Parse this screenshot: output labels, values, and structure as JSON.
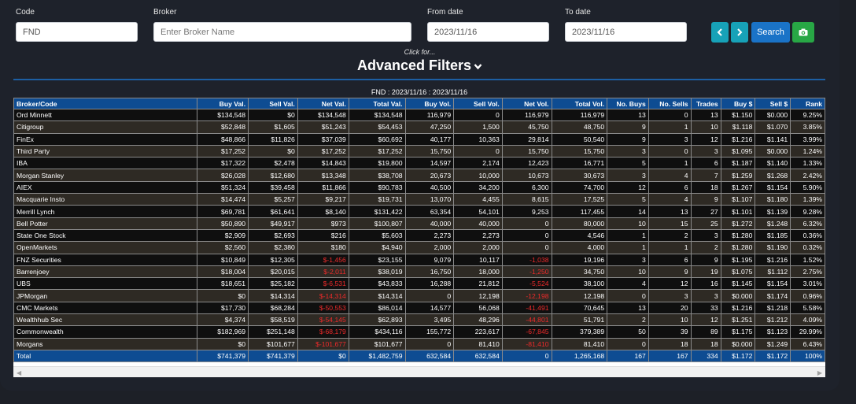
{
  "filters": {
    "code_label": "Code",
    "code_value": "FND",
    "broker_label": "Broker",
    "broker_placeholder": "Enter Broker Name",
    "from_label": "From date",
    "from_value": "2023/11/16",
    "to_label": "To date",
    "to_value": "2023/11/16",
    "search_label": "Search"
  },
  "advanced": {
    "click_for": "Click for...",
    "title": "Advanced Filters"
  },
  "caption": "FND : 2023/11/16 : 2023/11/16",
  "colors": {
    "header_bg": "#0e4c92",
    "negative": "#ee2a2a",
    "accent": "#1a73c7",
    "teal": "#17a2b8",
    "green": "#28a745"
  },
  "icons": {
    "prev": "chevron-left-icon",
    "next": "chevron-right-icon",
    "camera": "camera-icon",
    "advanced": "chevron-down-icon"
  },
  "table": {
    "columns": [
      "Broker/Code",
      "Buy Val.",
      "Sell Val.",
      "Net Val.",
      "Total Val.",
      "Buy Vol.",
      "Sell Vol.",
      "Net Vol.",
      "Total Vol.",
      "No. Buys",
      "No. Sells",
      "Trades",
      "Buy $",
      "Sell $",
      "Rank"
    ],
    "rows": [
      [
        "Ord Minnett",
        "$134,548",
        "$0",
        "$134,548",
        "$134,548",
        "116,979",
        "0",
        "116,979",
        "116,979",
        "13",
        "0",
        "13",
        "$1.150",
        "$0.000",
        "9.25%"
      ],
      [
        "Citigroup",
        "$52,848",
        "$1,605",
        "$51,243",
        "$54,453",
        "47,250",
        "1,500",
        "45,750",
        "48,750",
        "9",
        "1",
        "10",
        "$1.118",
        "$1.070",
        "3.85%"
      ],
      [
        "FinEx",
        "$48,866",
        "$11,826",
        "$37,039",
        "$60,692",
        "40,177",
        "10,363",
        "29,814",
        "50,540",
        "9",
        "3",
        "12",
        "$1.216",
        "$1.141",
        "3.99%"
      ],
      [
        "Third Party",
        "$17,252",
        "$0",
        "$17,252",
        "$17,252",
        "15,750",
        "0",
        "15,750",
        "15,750",
        "3",
        "0",
        "3",
        "$1.095",
        "$0.000",
        "1.24%"
      ],
      [
        "IBA",
        "$17,322",
        "$2,478",
        "$14,843",
        "$19,800",
        "14,597",
        "2,174",
        "12,423",
        "16,771",
        "5",
        "1",
        "6",
        "$1.187",
        "$1.140",
        "1.33%"
      ],
      [
        "Morgan Stanley",
        "$26,028",
        "$12,680",
        "$13,348",
        "$38,708",
        "20,673",
        "10,000",
        "10,673",
        "30,673",
        "3",
        "4",
        "7",
        "$1.259",
        "$1.268",
        "2.42%"
      ],
      [
        "AIEX",
        "$51,324",
        "$39,458",
        "$11,866",
        "$90,783",
        "40,500",
        "34,200",
        "6,300",
        "74,700",
        "12",
        "6",
        "18",
        "$1.267",
        "$1.154",
        "5.90%"
      ],
      [
        "Macquarie Insto",
        "$14,474",
        "$5,257",
        "$9,217",
        "$19,731",
        "13,070",
        "4,455",
        "8,615",
        "17,525",
        "5",
        "4",
        "9",
        "$1.107",
        "$1.180",
        "1.39%"
      ],
      [
        "Merrill Lynch",
        "$69,781",
        "$61,641",
        "$8,140",
        "$131,422",
        "63,354",
        "54,101",
        "9,253",
        "117,455",
        "14",
        "13",
        "27",
        "$1.101",
        "$1.139",
        "9.28%"
      ],
      [
        "Bell Potter",
        "$50,890",
        "$49,917",
        "$973",
        "$100,807",
        "40,000",
        "40,000",
        "0",
        "80,000",
        "10",
        "15",
        "25",
        "$1.272",
        "$1.248",
        "6.32%"
      ],
      [
        "State One Stock",
        "$2,909",
        "$2,693",
        "$216",
        "$5,603",
        "2,273",
        "2,273",
        "0",
        "4,546",
        "1",
        "2",
        "3",
        "$1.280",
        "$1.185",
        "0.36%"
      ],
      [
        "OpenMarkets",
        "$2,560",
        "$2,380",
        "$180",
        "$4,940",
        "2,000",
        "2,000",
        "0",
        "4,000",
        "1",
        "1",
        "2",
        "$1.280",
        "$1.190",
        "0.32%"
      ],
      [
        "FNZ Securities",
        "$10,849",
        "$12,305",
        "$-1,456",
        "$23,155",
        "9,079",
        "10,117",
        "-1,038",
        "19,196",
        "3",
        "6",
        "9",
        "$1.195",
        "$1.216",
        "1.52%"
      ],
      [
        "Barrenjoey",
        "$18,004",
        "$20,015",
        "$-2,011",
        "$38,019",
        "16,750",
        "18,000",
        "-1,250",
        "34,750",
        "10",
        "9",
        "19",
        "$1.075",
        "$1.112",
        "2.75%"
      ],
      [
        "UBS",
        "$18,651",
        "$25,182",
        "$-6,531",
        "$43,833",
        "16,288",
        "21,812",
        "-5,524",
        "38,100",
        "4",
        "12",
        "16",
        "$1.145",
        "$1.154",
        "3.01%"
      ],
      [
        "JPMorgan",
        "$0",
        "$14,314",
        "$-14,314",
        "$14,314",
        "0",
        "12,198",
        "-12,198",
        "12,198",
        "0",
        "3",
        "3",
        "$0.000",
        "$1.174",
        "0.96%"
      ],
      [
        "CMC Markets",
        "$17,730",
        "$68,284",
        "$-50,553",
        "$86,014",
        "14,577",
        "56,068",
        "-41,491",
        "70,645",
        "13",
        "20",
        "33",
        "$1.216",
        "$1.218",
        "5.58%"
      ],
      [
        "Wealthhub Sec",
        "$4,374",
        "$58,519",
        "$-54,145",
        "$62,893",
        "3,495",
        "48,296",
        "-44,801",
        "51,791",
        "2",
        "10",
        "12",
        "$1.251",
        "$1.212",
        "4.09%"
      ],
      [
        "Commonwealth",
        "$182,969",
        "$251,148",
        "$-68,179",
        "$434,116",
        "155,772",
        "223,617",
        "-67,845",
        "379,389",
        "50",
        "39",
        "89",
        "$1.175",
        "$1.123",
        "29.99%"
      ],
      [
        "Morgans",
        "$0",
        "$101,677",
        "$-101,677",
        "$101,677",
        "0",
        "81,410",
        "-81,410",
        "81,410",
        "0",
        "18",
        "18",
        "$0.000",
        "$1.249",
        "6.43%"
      ]
    ],
    "total": [
      "Total",
      "$741,379",
      "$741,379",
      "$0",
      "$1,482,759",
      "632,584",
      "632,584",
      "0",
      "1,265,168",
      "167",
      "167",
      "334",
      "$1.172",
      "$1.172",
      "100%"
    ]
  }
}
